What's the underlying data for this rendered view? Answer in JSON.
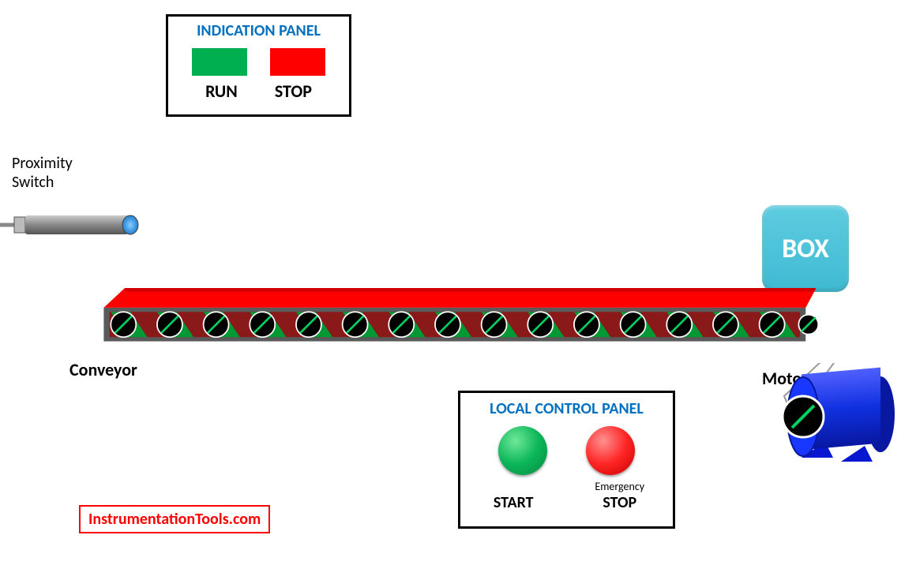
{
  "indication_panel": {
    "title": "INDICATION PANEL",
    "run_label": "RUN",
    "stop_label": "STOP"
  },
  "proximity_label_line1": "Proximity",
  "proximity_label_line2": "Switch",
  "box_label": "BOX",
  "conveyor_label": "Conveyor",
  "motor_label": "Motor",
  "local_panel": {
    "title": "LOCAL CONTROL  PANEL",
    "start_label": "START",
    "emergency_label": "Emergency",
    "stop_label": "STOP"
  },
  "watermark": "InstrumentationTools.com",
  "colors": {
    "green": "#00B050",
    "red": "#FF0000",
    "blue_text": "#0070C0",
    "box_blue": "#3FBAD2",
    "motor_blue": "#1030E0"
  }
}
